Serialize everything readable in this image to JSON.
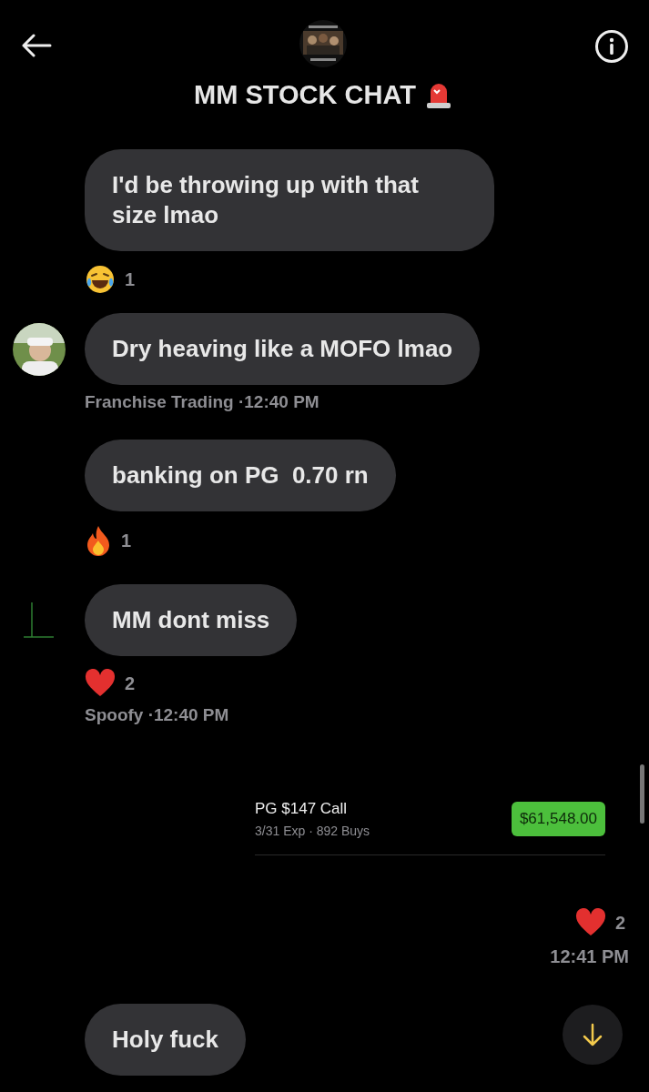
{
  "header": {
    "title": "MM STOCK CHAT"
  },
  "messages": [
    {
      "kind": "bubble",
      "text": "I'd be throwing up with that size lmao",
      "reaction": {
        "kind": "laugh",
        "count": "1"
      }
    },
    {
      "kind": "bubble",
      "text": "Dry heaving like a MOFO lmao",
      "meta": "Franchise Trading ·12:40 PM"
    },
    {
      "kind": "bubble",
      "text": "banking on PG  0.70 rn",
      "reaction": {
        "kind": "fire",
        "count": "1"
      }
    },
    {
      "kind": "bubble",
      "text": "MM dont miss",
      "avatar": {
        "kind": "chart"
      },
      "reaction": {
        "kind": "heart",
        "count": "2"
      },
      "meta": "Spoofy ·12:40 PM"
    },
    {
      "kind": "trade",
      "title": "PG $147 Call",
      "detail": "3/31 Exp · 892 Buys",
      "amount": "$61,548.00",
      "reaction": {
        "kind": "heart",
        "count": "2"
      },
      "meta": "12:41 PM"
    },
    {
      "kind": "bubble",
      "text": "Holy fuck"
    }
  ]
}
